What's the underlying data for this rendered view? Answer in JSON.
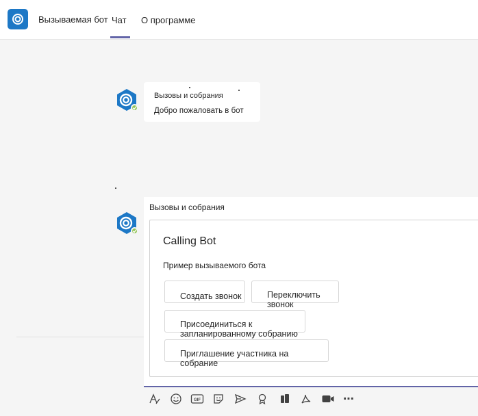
{
  "header": {
    "app_title": "Вызываемая бот",
    "tabs": [
      {
        "label": "Чат",
        "active": true
      },
      {
        "label": "О программе",
        "active": false
      }
    ],
    "accent": "#6264a7",
    "app_icon_color": "#1d78c6"
  },
  "messages": [
    {
      "sender": "Вызовы и собрания",
      "text": "Добро пожаловать в бот"
    },
    {
      "sender": "Вызовы и собрания",
      "card": {
        "title": "Calling Bot",
        "subtitle": "Пример вызываемого бота",
        "buttons": [
          "Создать звонок",
          "Переключить звонок",
          "Присоединиться к запланированному собранию",
          "Приглашение участника на собрание"
        ]
      }
    }
  ],
  "toolbar": {
    "icons": [
      "format-icon",
      "emoji-icon",
      "gif-icon",
      "sticker-icon",
      "send-icon",
      "praise-icon",
      "apps-icon",
      "pdf-icon",
      "video-icon",
      "more-icon"
    ],
    "gif_label": "GIF",
    "more_label": "⋯"
  },
  "colors": {
    "bot_blue": "#1d78c6",
    "presence_green": "#92c353"
  }
}
